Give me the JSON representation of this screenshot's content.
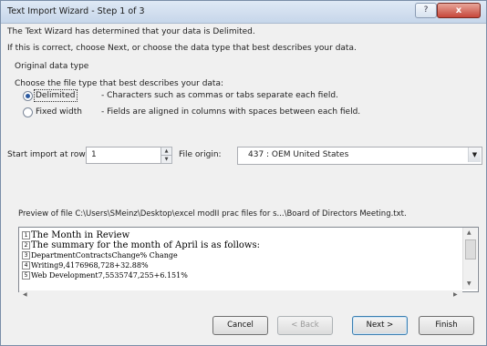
{
  "window": {
    "title": "Text Import Wizard - Step 1 of 3",
    "help_label": "?",
    "close_label": "x"
  },
  "intro": {
    "line1": "The Text Wizard has determined that your data is Delimited.",
    "line2": "If this is correct, choose Next, or choose the data type that best describes your data."
  },
  "data_type": {
    "group_label": "Original data type",
    "prompt": "Choose the file type that best describes your data:",
    "options": [
      {
        "label": "Delimited",
        "description": "- Characters such as commas or tabs separate each field.",
        "selected": true
      },
      {
        "label": "Fixed width",
        "description": "- Fields are aligned in columns with spaces between each field.",
        "selected": false
      }
    ]
  },
  "start_row": {
    "label": "Start import at row:",
    "value": "1"
  },
  "file_origin": {
    "label": "File origin:",
    "value": "437 : OEM United States"
  },
  "preview": {
    "caption": "Preview of file C:\\Users\\SMeinz\\Desktop\\excel modII prac files for s...\\Board of Directors Meeting.txt.",
    "lines": [
      {
        "num": "1",
        "text": "The Month in Review"
      },
      {
        "num": "2",
        "text": "The summary for the month of April is as follows:"
      },
      {
        "num": "3",
        "text": "DepartmentContractsChange% Change"
      },
      {
        "num": "4",
        "text": "Writing9,4176968,728+32.88%"
      },
      {
        "num": "5",
        "text": "Web Development7,5535747,255+6.151%"
      }
    ]
  },
  "buttons": {
    "cancel": "Cancel",
    "back": "< Back",
    "next": "Next >",
    "finish": "Finish"
  }
}
